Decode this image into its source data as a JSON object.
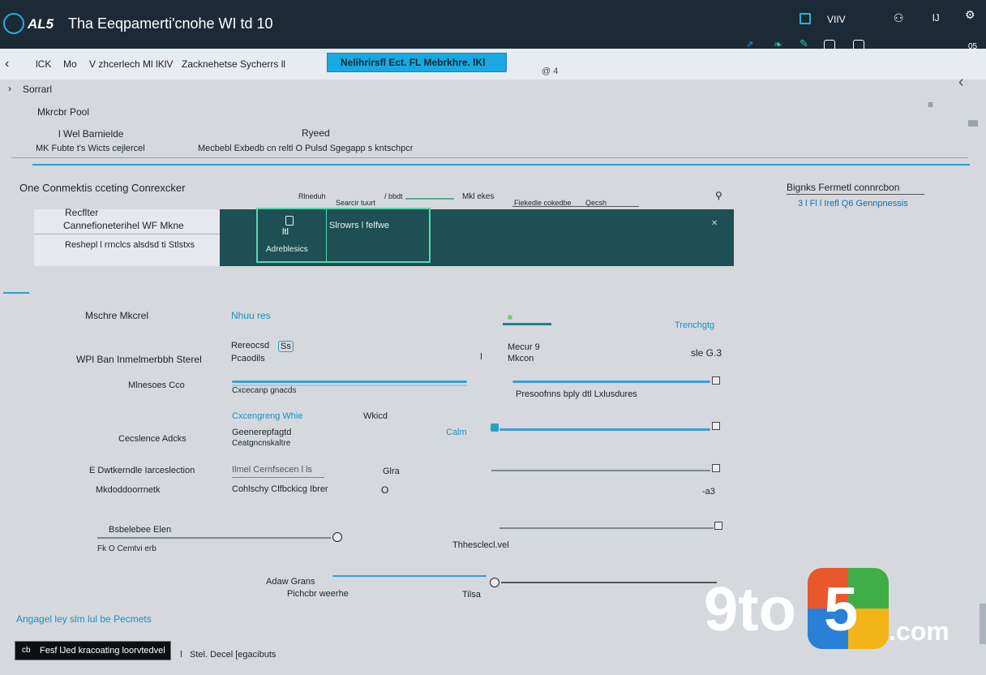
{
  "window": {
    "brand": "AL5",
    "title": "Tha Eeqpamerti'cnohe WI td 10",
    "top_right": [
      "VIIV",
      "lJ"
    ],
    "counter": "05"
  },
  "nav": {
    "items": [
      "lCK",
      "Mo",
      "V zhcerlech Ml lKlV",
      "Zacknehetse Sycherrs ll"
    ],
    "highlight_tab": "Nelihrirsfl  Ect. FL Mebrkhre. lKl",
    "right_label": "@ 4"
  },
  "section": {
    "crumb": "Sorrarl",
    "subtitle": "Mkrcbr Pool",
    "col1_head": "l Wel Barnielde",
    "col1_value": "MK Fubte t's Wicts cejlercel",
    "col2_head": "Ryeed",
    "col2_value": "Mecbebl Exbedb cn reltl O Pulsd Sgegapp s kntschpcr"
  },
  "connections": {
    "title": "One Conmektis cceting Conrexcker",
    "mini_labels": [
      "Rlneduh",
      "Searcir tuurt",
      "/ bbdt",
      "Mkl ekes",
      "Fiekedle cokedbe",
      "Qecsh"
    ],
    "right_title": "Bignks Fermetl  connrcbon",
    "right_sub": "3 l Fl l Irefl Q6 Gennpnessis",
    "left_label1": "Recflter",
    "left_label2": "Cannefioneterihel WF Mkne",
    "left_label3": "Reshepl l rrnclcs alsdsd ti Stlstxs",
    "card_title": "ltl",
    "card_sub": "Adreblesics",
    "card_text": "Slrowrs l felfwe"
  },
  "settings": {
    "row1_label": "Mschre Mkcrel",
    "row1_value": "Nhuu res",
    "row1_right": "Trenchgtg",
    "row2_label": "WPl Ban Inmelmerbbh Sterel",
    "row2_head": "Rereocsd",
    "row2_badge": "Ss",
    "row2_sub": "Pcaodils",
    "row2_mid": "Mecur 9",
    "row2_mid2": "Mkcon",
    "row2_right": "sle G.3",
    "row3_label": "Mlnesoes Cco",
    "row3_sub": "Cxcecanp gnacds",
    "row3_right_sub": "Presoofnns bply dtl  Lxlusdures",
    "row4_label_a": "Cxcengreng Whie",
    "row4_label_b": "Wkicd",
    "row4_label": "Cecslence  Adcks",
    "row4_head": "Geenerepfagtd",
    "row4_sub": "Ceatgncnskaltre",
    "row4_mid": "Calm",
    "row5_label": "E Dwtkerndle Iarceslection",
    "row5_value": "Ilmel Cernfsecen l ls",
    "row5_mid": "Glra",
    "row6_label": "Mkdoddoorrnetk",
    "row6_value": "Cohlschy Clfbckicg Ibrer",
    "row6_mid": "O",
    "row6_right": "-a3",
    "row7_label": "Bsbelebee Elen",
    "row7_sub": "Fk O Cemtvi erb",
    "row7_mid": "Thhesclecl.vel",
    "row8_label": "Adaw Grans",
    "row8_sub": "Pichcbr weerhe",
    "row8_mid": "Tilsa"
  },
  "footer": {
    "link": "Angagel ley slm lul be Pecmets",
    "box_text": "Fesf lJed kracoating loorvtedvel",
    "box_icon": "cb",
    "status": "Stel. Decel [egacibuts"
  },
  "watermark": {
    "text1": "9to",
    "text2": "5",
    "text3": ".com"
  },
  "colors": {
    "titlebar": "#1b2a36",
    "accent": "#1aa8e0",
    "panel": "#1e4f54",
    "card_border": "#58d6b0"
  }
}
